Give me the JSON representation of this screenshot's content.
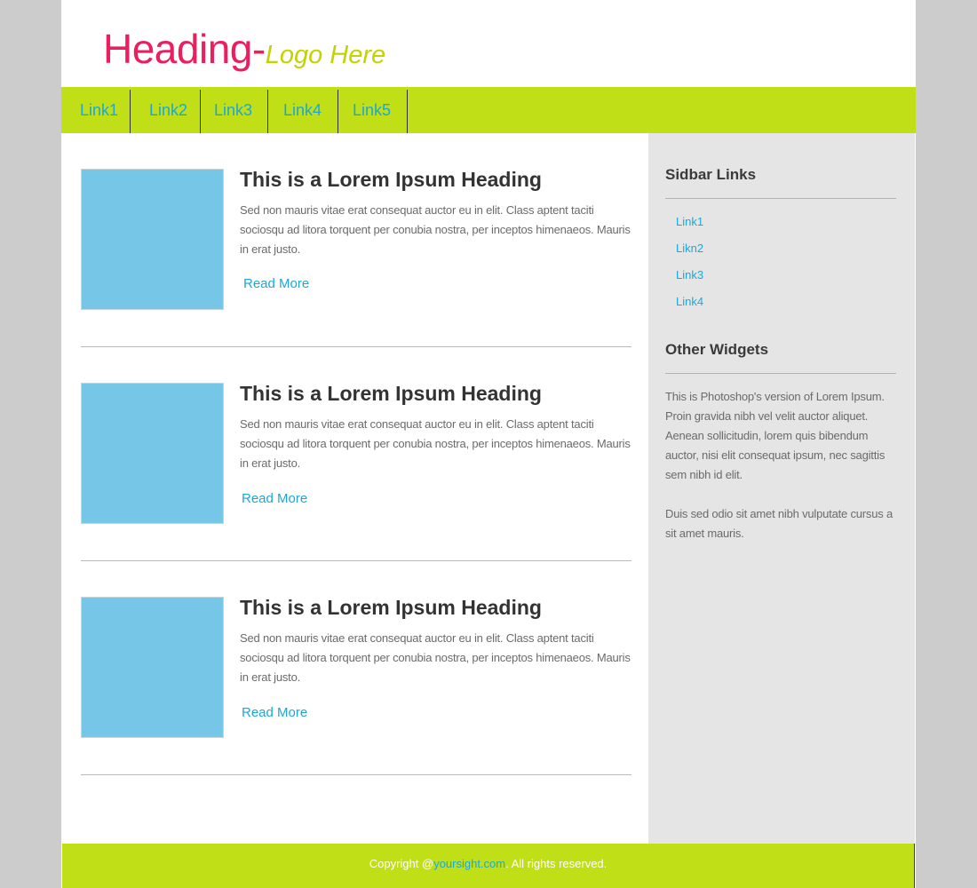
{
  "header": {
    "logo_main": "Heading-",
    "logo_sub": "Logo Here"
  },
  "nav": {
    "items": [
      {
        "label": "Link1"
      },
      {
        "label": "Link2"
      },
      {
        "label": "Link3"
      },
      {
        "label": "Link4"
      },
      {
        "label": "Link5"
      }
    ]
  },
  "posts": [
    {
      "title": "This is a Lorem Ipsum  Heading",
      "body": "Sed non  mauris vitae erat consequat auctor eu in elit. Class aptent taciti sociosqu ad litora torquent per conubia nostra, per inceptos himenaeos. Mauris in erat justo.",
      "read_more": "Read More"
    },
    {
      "title": "This is a Lorem Ipsum  Heading",
      "body": "Sed non  mauris vitae erat consequat auctor eu in elit. Class aptent taciti sociosqu ad litora torquent per conubia nostra, per inceptos himenaeos. Mauris in erat justo.",
      "read_more": "Read More"
    },
    {
      "title": "This is a Lorem Ipsum  Heading",
      "body": "Sed non  mauris vitae erat consequat auctor eu in elit. Class aptent taciti sociosqu ad litora torquent per conubia nostra, per inceptos himenaeos. Mauris in erat justo.",
      "read_more": "Read More"
    }
  ],
  "sidebar": {
    "links_heading": "Sidbar Links",
    "links": [
      {
        "label": "Link1"
      },
      {
        "label": "Likn2"
      },
      {
        "label": "Link3"
      },
      {
        "label": "Link4"
      }
    ],
    "widgets_heading": "Other Widgets",
    "widgets_para1": "This is Photoshop's version  of Lorem Ipsum. Proin gravida nibh vel velit auctor aliquet. Aenean sollicitudin, lorem quis bibendum auctor, nisi elit consequat ipsum, nec sagittis sem nibh id elit.",
    "widgets_para2": "Duis sed odio sit amet nibh vulputate cursus a sit amet mauris."
  },
  "footer": {
    "prefix": "Copyright @",
    "link": "yoursight.com",
    "suffix": ". All rights reserved."
  },
  "colors": {
    "page_bg": "#cccccc",
    "accent_green": "#c0df16",
    "link_blue": "#1ba8d8",
    "logo_pink": "#ea1f5f",
    "logo_lime": "#c3d300",
    "thumb_blue": "#76c6e8",
    "sidebar_bg": "#e5e5e5"
  }
}
